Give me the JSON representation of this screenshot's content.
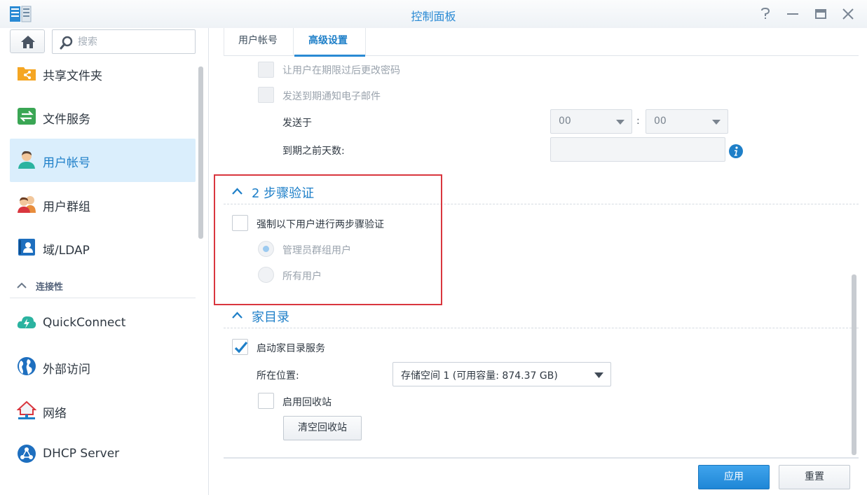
{
  "window": {
    "title": "控制面板",
    "controls": [
      "help-icon",
      "minimize-icon",
      "maximize-icon",
      "close-icon"
    ]
  },
  "sidebar": {
    "search_placeholder": "搜索",
    "items": [
      {
        "label": "共享文件夹",
        "icon": "shared-folder-icon",
        "active": false
      },
      {
        "label": "文件服务",
        "icon": "file-services-icon",
        "active": false
      },
      {
        "label": "用户帐号",
        "icon": "user-icon",
        "active": true
      },
      {
        "label": "用户群组",
        "icon": "group-icon",
        "active": false
      },
      {
        "label": "域/LDAP",
        "icon": "domain-ldap-icon",
        "active": false
      }
    ],
    "group_header": "连接性",
    "connectivity_items": [
      {
        "label": "QuickConnect",
        "icon": "quickconnect-icon"
      },
      {
        "label": "外部访问",
        "icon": "globe-icon"
      },
      {
        "label": "网络",
        "icon": "network-icon"
      },
      {
        "label": "DHCP Server",
        "icon": "dhcp-icon"
      }
    ]
  },
  "tabs": [
    {
      "label": "用户帐号",
      "active": false
    },
    {
      "label": "高级设置",
      "active": true
    }
  ],
  "password_expiry": {
    "allow_change_after_expiry": "让用户在期限过后更改密码",
    "send_expiry_email": "发送到期通知电子邮件",
    "send_at_label": "发送于",
    "hour_value": "00",
    "time_separator": ":",
    "minute_value": "00",
    "days_before_label": "到期之前天数:"
  },
  "two_step": {
    "title": "2 步骤验证",
    "enforce_label": "强制以下用户进行两步骤验证",
    "enforce_checked": false,
    "option_admins": "管理员群组用户",
    "option_all": "所有用户",
    "selected": "admins"
  },
  "home_dir": {
    "title": "家目录",
    "enable_label": "启动家目录服务",
    "enable_checked": true,
    "location_label": "所在位置:",
    "location_value": "存储空间 1 (可用容量:  874.37 GB)",
    "recycle_label": "启用回收站",
    "recycle_checked": false,
    "empty_recycle_button": "清空回收站"
  },
  "footer": {
    "apply": "应用",
    "reset": "重置"
  },
  "colors": {
    "accent": "#1e7fc8",
    "highlight": "#d9363e",
    "active_nav_bg": "#daeefc"
  }
}
